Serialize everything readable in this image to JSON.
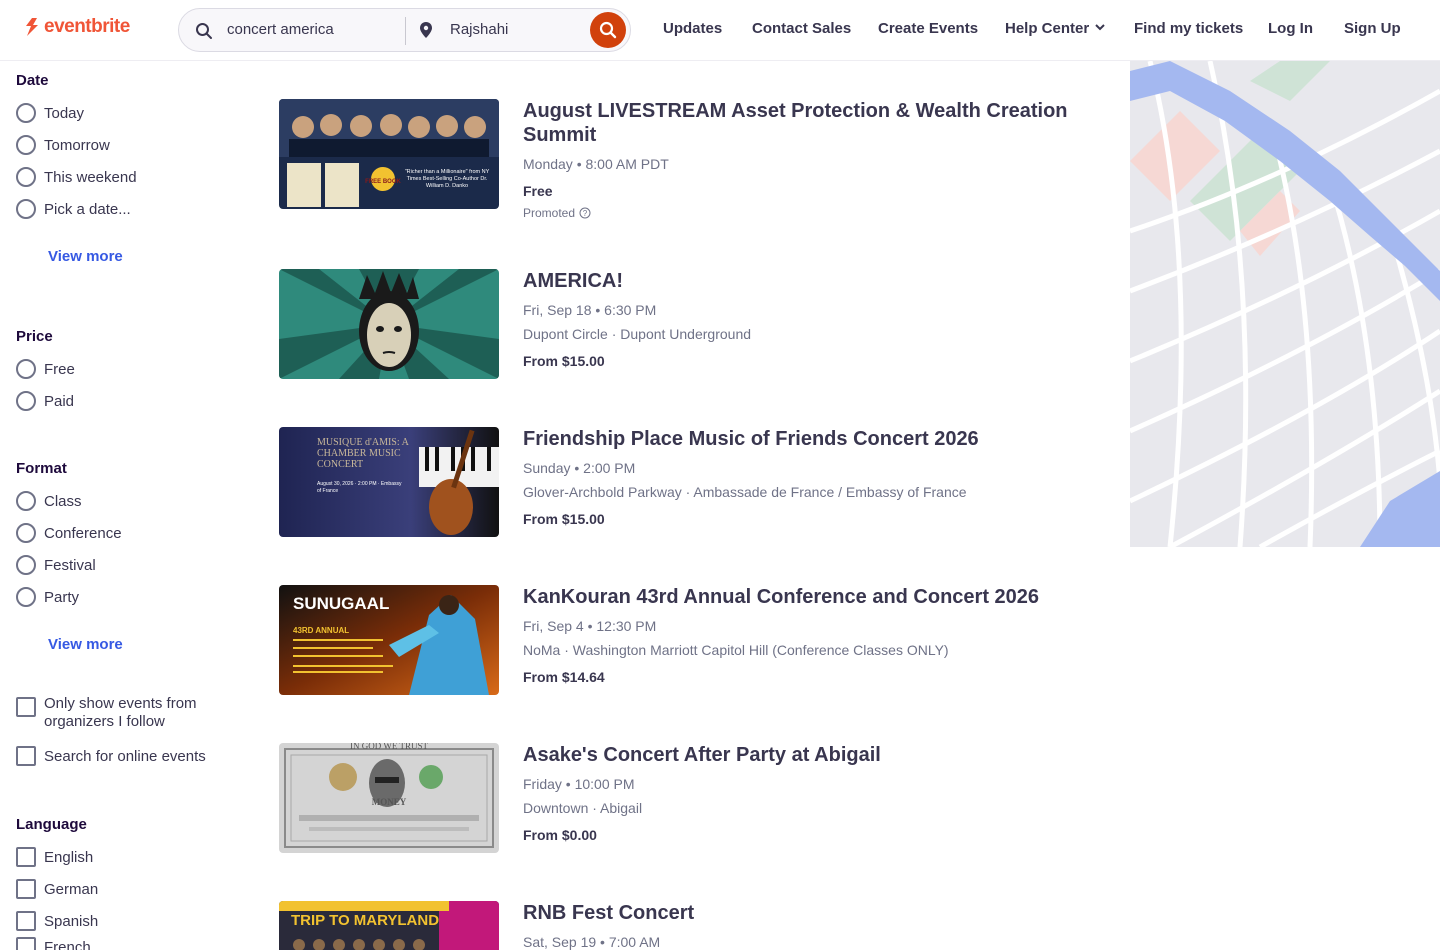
{
  "header": {
    "logo_text": "eventbrite",
    "search_query": "concert america",
    "search_location": "Rajshahi",
    "nav": [
      "Updates",
      "Contact Sales",
      "Create Events",
      "Help Center",
      "Find my tickets",
      "Log In",
      "Sign Up"
    ]
  },
  "sidebar": {
    "date": {
      "title": "Date",
      "options": [
        "Today",
        "Tomorrow",
        "This weekend",
        "Pick a date..."
      ],
      "view_more": "View more"
    },
    "price": {
      "title": "Price",
      "options": [
        "Free",
        "Paid"
      ]
    },
    "format": {
      "title": "Format",
      "options": [
        "Class",
        "Conference",
        "Festival",
        "Party"
      ],
      "view_more": "View more"
    },
    "toggles": [
      "Only show events from organizers I follow",
      "Search for online events"
    ],
    "language": {
      "title": "Language",
      "options": [
        "English",
        "German",
        "Spanish",
        "French"
      ]
    }
  },
  "events": [
    {
      "title": "August LIVESTREAM Asset Protection & Wealth Creation Summit",
      "date": "Monday • 8:00 AM PDT",
      "location": "",
      "price": "Free",
      "promoted": "Promoted",
      "thumb_color": "#1b2a4a"
    },
    {
      "title": "AMERICA!",
      "date": "Fri, Sep 18 • 6:30 PM",
      "location": "Dupont Circle · Dupont Underground",
      "price": "From $15.00",
      "promoted": "",
      "thumb_color": "#2f8a7c"
    },
    {
      "title": "Friendship Place Music of Friends Concert 2026",
      "date": "Sunday • 2:00 PM",
      "location": "Glover-Archbold Parkway · Ambassade de France / Embassy of France",
      "price": "From $15.00",
      "promoted": "",
      "thumb_color": "#1f2452"
    },
    {
      "title": "KanKouran 43rd Annual Conference and Concert 2026",
      "date": "Fri, Sep 4 • 12:30 PM",
      "location": "NoMa · Washington Marriott Capitol Hill (Conference Classes ONLY)",
      "price": "From $14.64",
      "promoted": "",
      "thumb_color": "#1a1a1a"
    },
    {
      "title": "Asake's Concert After Party at Abigail",
      "date": "Friday • 10:00 PM",
      "location": "Downtown · Abigail",
      "price": "From $0.00",
      "promoted": "",
      "thumb_color": "#cfcfcf"
    },
    {
      "title": "RNB Fest Concert",
      "date": "Sat, Sep 19 • 7:00 AM",
      "location": "",
      "price": "",
      "promoted": "",
      "thumb_color": "#2a2a3a"
    }
  ],
  "thumb_text": {
    "t1": "\"Richer than a Millionaire\" from NY Times Best-Selling Co-Author Dr. William D. Danko",
    "t1_badge": "FREE BOOK",
    "t3_title": "MUSIQUE d'AMIS: A CHAMBER MUSIC CONCERT",
    "t3_sub": "August 30, 2026 · 2:00 PM · Embassy of France",
    "t4_title": "SUNUGAAL",
    "t4_sub": "43RD ANNUAL",
    "t5_top": "IN GOD WE TRUST",
    "t5_mid": "MONEY",
    "t6_title": "TRIP TO MARYLAND"
  }
}
